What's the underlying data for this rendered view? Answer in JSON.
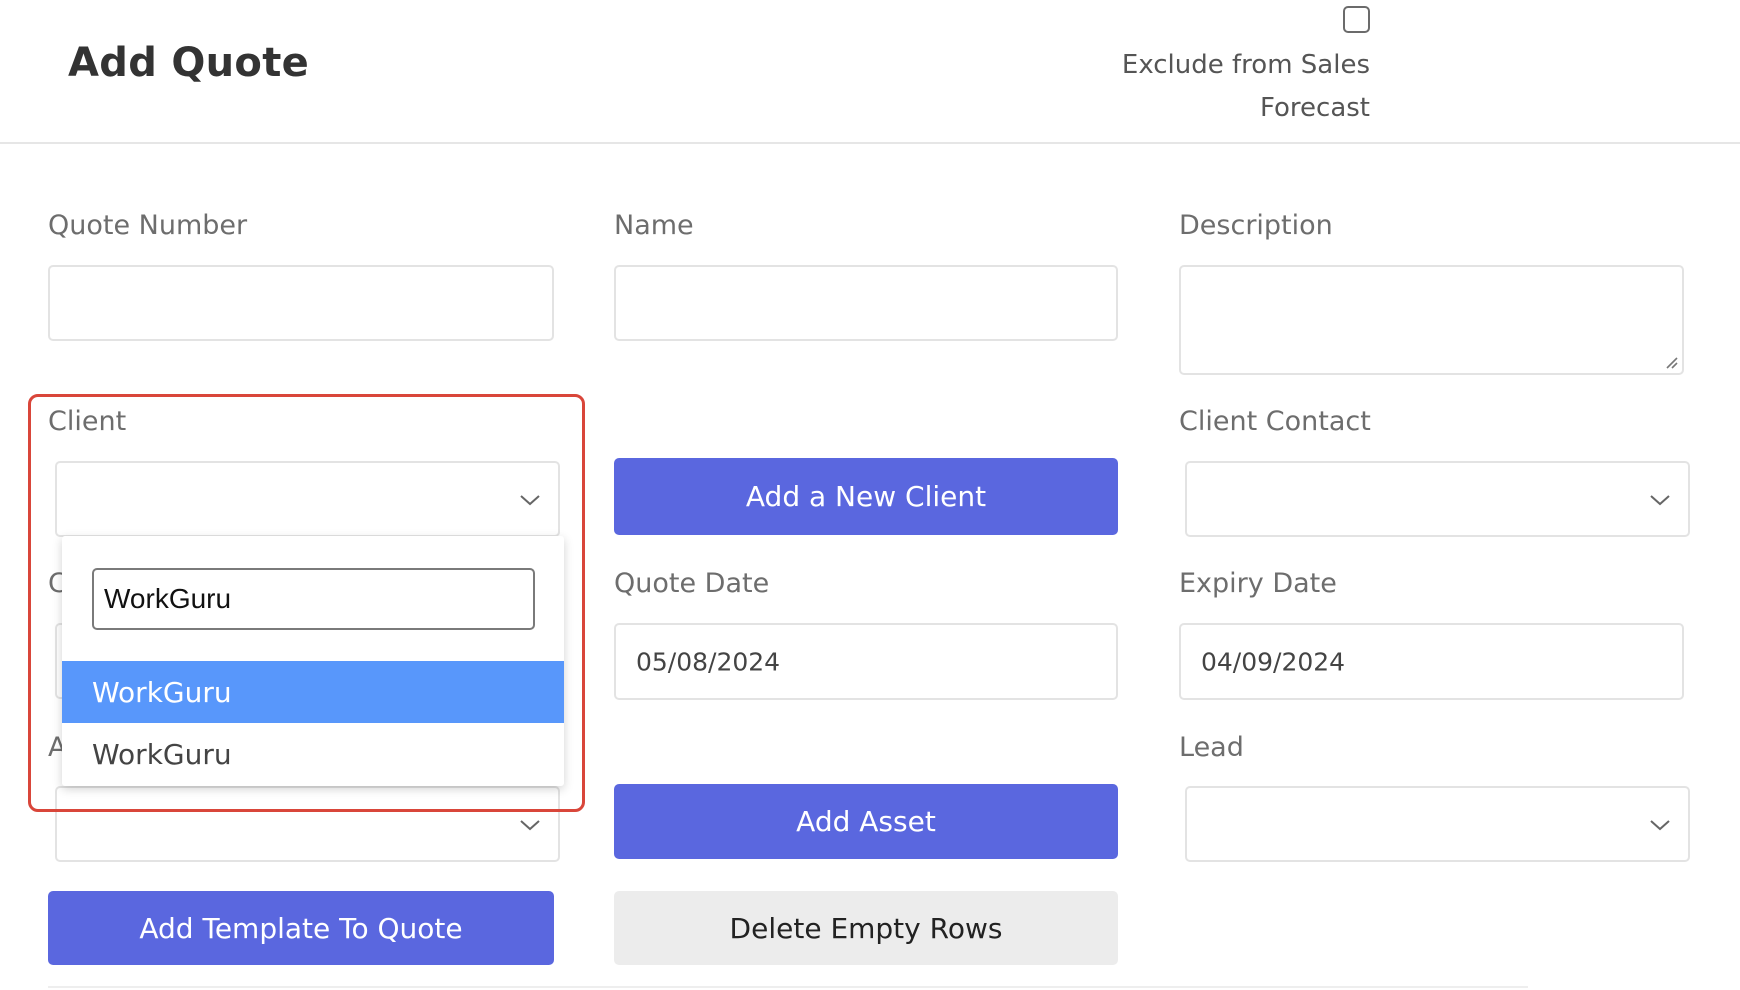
{
  "header": {
    "title": "Add Quote",
    "exclude_label": "Exclude from Sales Forecast",
    "exclude_checked": false
  },
  "form": {
    "quote_number": {
      "label": "Quote Number",
      "value": ""
    },
    "name": {
      "label": "Name",
      "value": ""
    },
    "description": {
      "label": "Description",
      "value": ""
    },
    "client": {
      "label": "Client",
      "selected": ""
    },
    "client_contact": {
      "label": "Client Contact",
      "selected": ""
    },
    "quote_date": {
      "label": "Quote Date",
      "value": "05/08/2024"
    },
    "expiry_date": {
      "label": "Expiry Date",
      "value": "04/09/2024"
    },
    "lead": {
      "label": "Lead",
      "selected": ""
    },
    "hidden_label_1": "C",
    "hidden_label_2": "A"
  },
  "buttons": {
    "add_new_client": "Add a New Client",
    "add_asset": "Add Asset",
    "add_template": "Add Template To Quote",
    "delete_empty_rows": "Delete Empty Rows"
  },
  "client_dropdown": {
    "search_value": "WorkGuru",
    "options": [
      {
        "label": "WorkGuru",
        "highlighted": true
      },
      {
        "label": "WorkGuru",
        "highlighted": false
      }
    ]
  },
  "colors": {
    "primary": "#5a67df",
    "option_highlight": "#5897fb",
    "annotation_border": "#d9463a"
  }
}
